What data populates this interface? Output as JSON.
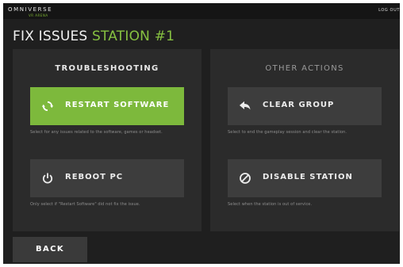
{
  "header": {
    "brand": "OMNIVERSE",
    "brand_sub": "VR ARENA",
    "logout_label": "LOG OUT"
  },
  "page": {
    "title_prefix": "FIX ISSUES",
    "title_station": "STATION #1"
  },
  "troubleshooting": {
    "heading": "TROUBLESHOOTING",
    "restart": {
      "label": "RESTART SOFTWARE",
      "icon": "refresh-icon",
      "description": "Select for any issues related to the software, games or headset."
    },
    "reboot": {
      "label": "REBOOT PC",
      "icon": "power-icon",
      "description": "Only select if \"Restart Software\" did not fix the issue."
    }
  },
  "other_actions": {
    "heading": "OTHER ACTIONS",
    "clear_group": {
      "label": "CLEAR GROUP",
      "icon": "reply-arrow-icon",
      "description": "Select to end the gameplay session and clear the station."
    },
    "disable_station": {
      "label": "DISABLE STATION",
      "icon": "disabled-circle-icon",
      "description": "Select when the station is out of service."
    }
  },
  "footer": {
    "back_label": "BACK"
  },
  "colors": {
    "accent_green": "#7db93c",
    "title_green": "#86c041",
    "background": "#1f1f1f",
    "panel": "#2b2b2b",
    "button_grey": "#3d3d3d"
  }
}
